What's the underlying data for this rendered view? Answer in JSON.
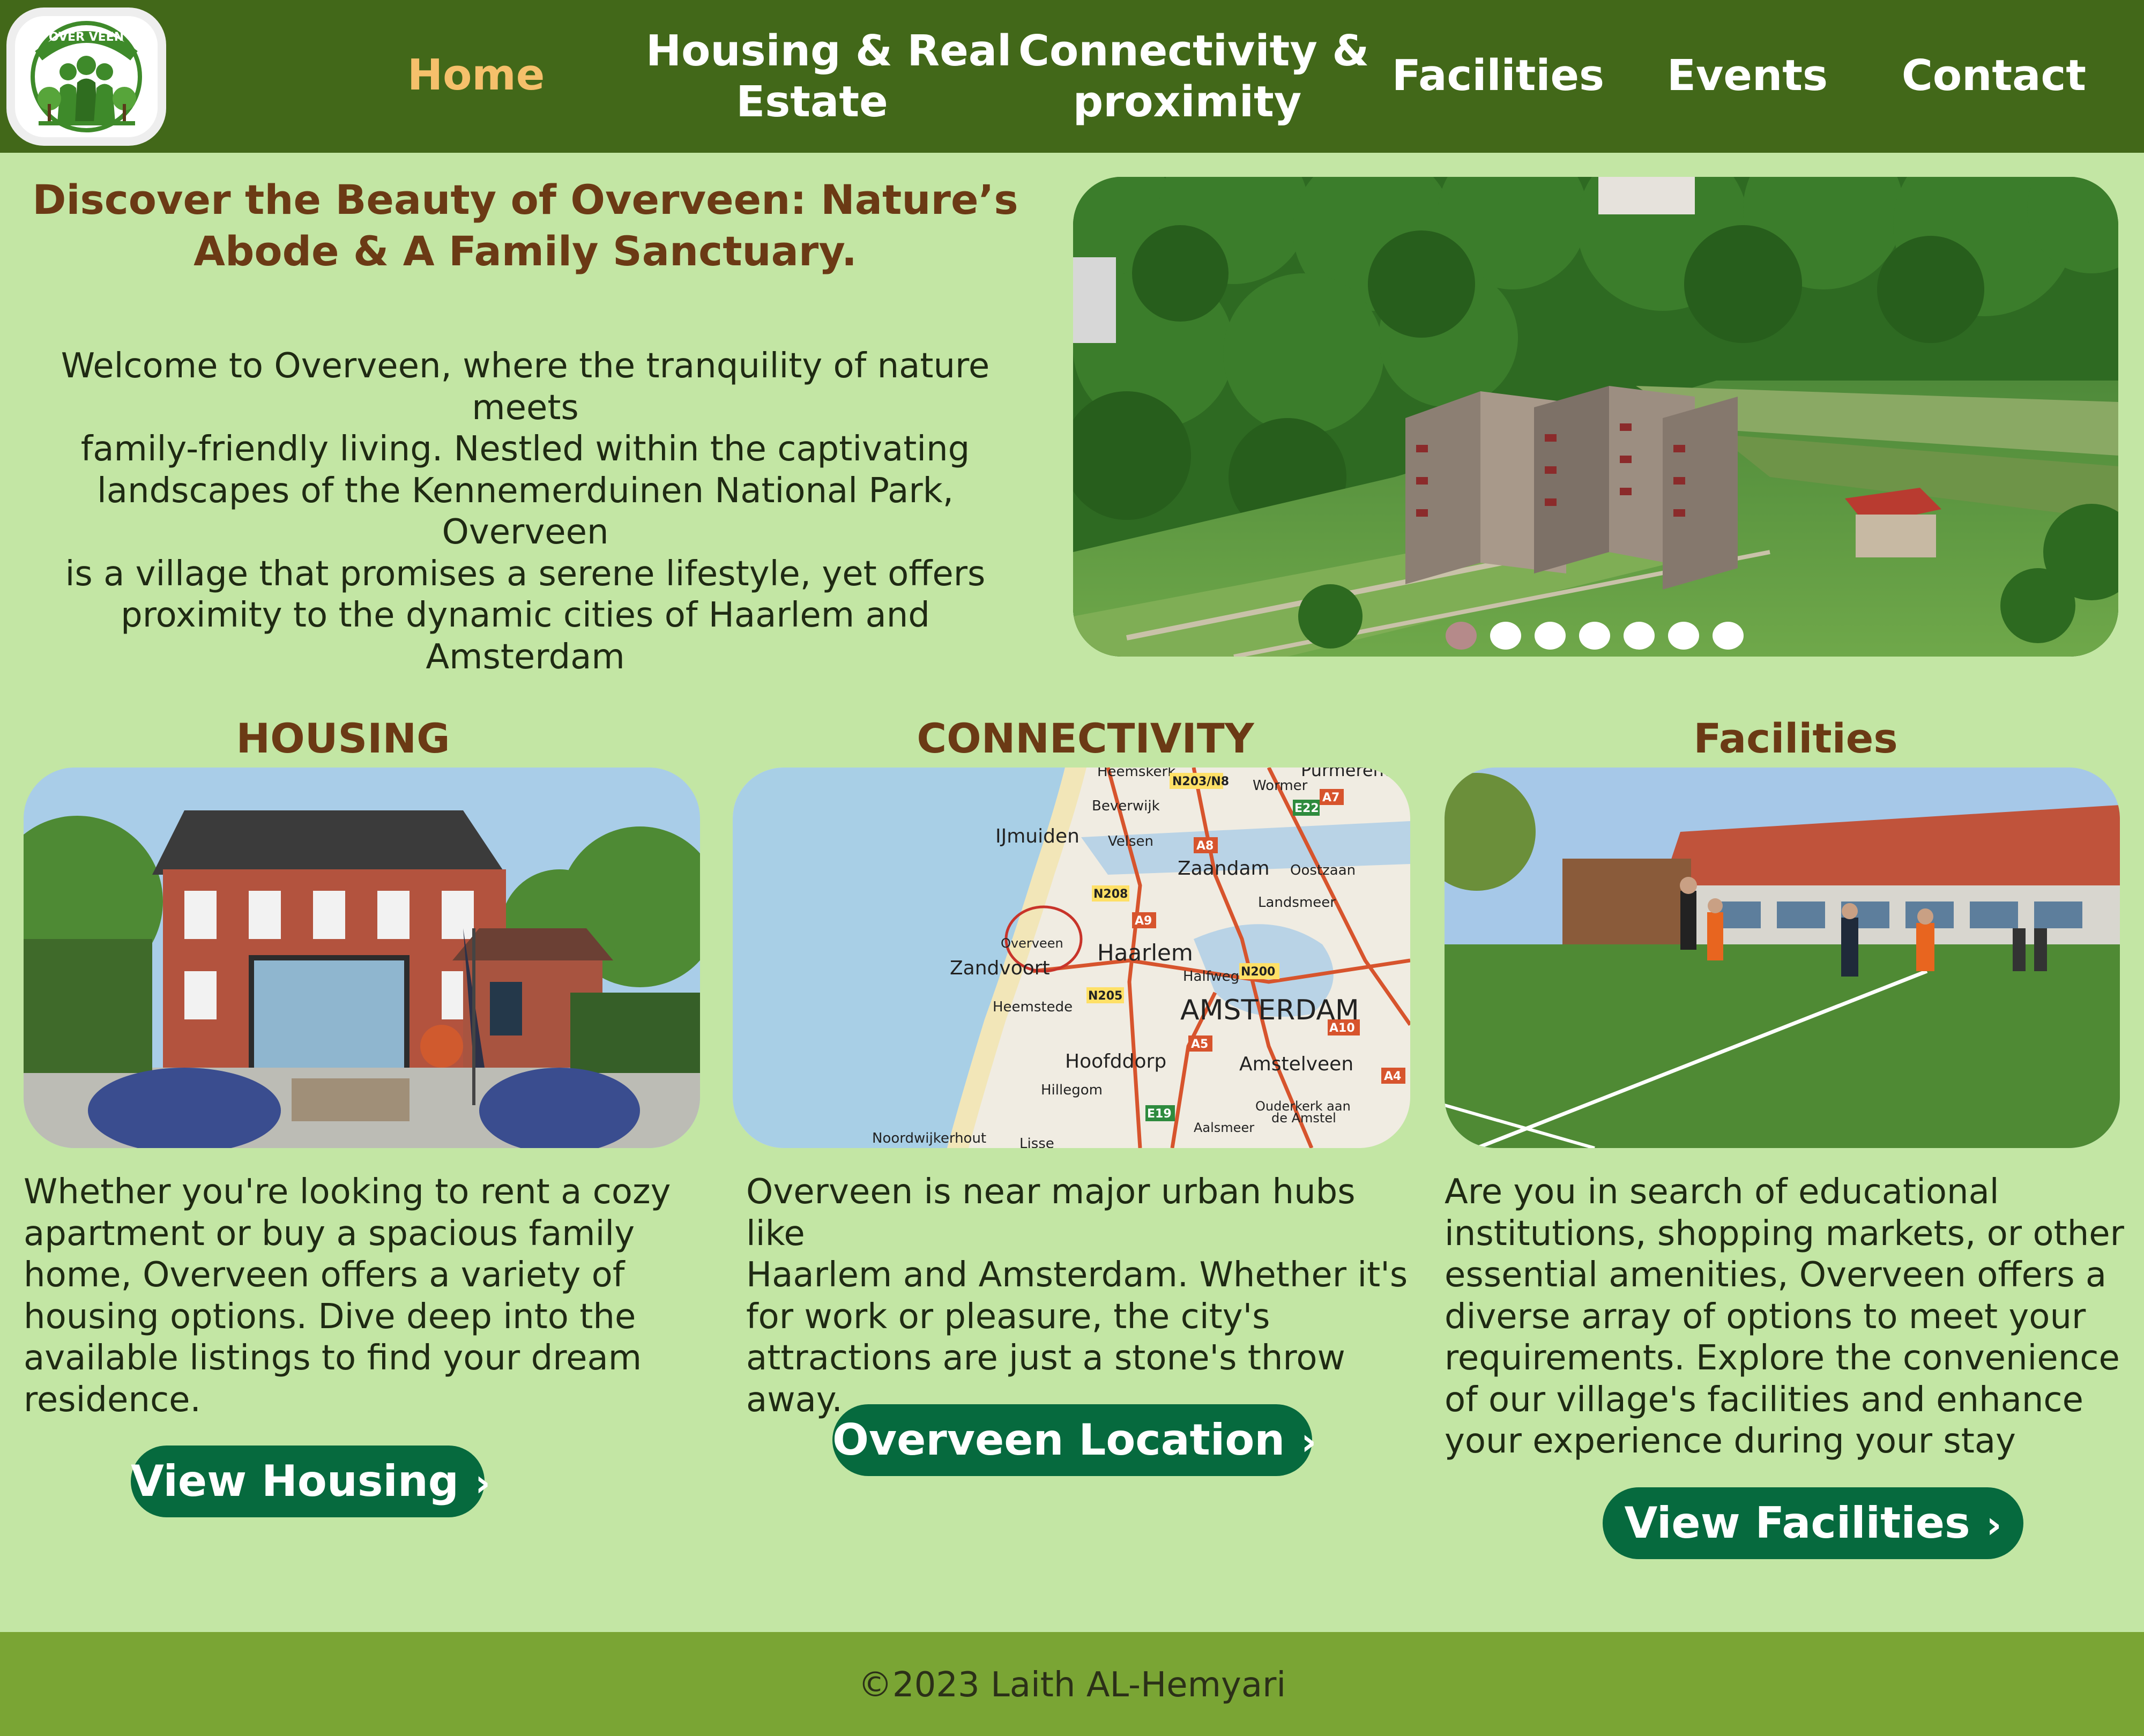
{
  "nav": {
    "items": [
      {
        "label": "Home",
        "active": true
      },
      {
        "label": "Housing & Real",
        "label2": "Estate"
      },
      {
        "label": "Connectivity &",
        "label2": "proximity"
      },
      {
        "label": "Facilities"
      },
      {
        "label": "Events"
      },
      {
        "label": "Contact"
      }
    ],
    "logo_text": "OVER VEEN"
  },
  "hero": {
    "title_line1": "Discover the Beauty of Overveen: Nature’s",
    "title_line2": "Abode & A Family Sanctuary.",
    "lines": [
      "Welcome to Overveen, where the tranquility of nature meets",
      "family-friendly living. Nestled within the captivating",
      "landscapes of the Kennemerduinen National Park, Overveen",
      "is a village that promises a serene lifestyle, yet offers",
      "proximity to the dynamic cities of Haarlem and Amsterdam"
    ],
    "carousel_active_index": 0,
    "carousel_count": 7
  },
  "housing": {
    "title": "HOUSING",
    "lines": [
      "Whether you're looking to rent a cozy",
      "apartment or buy a spacious family",
      "home, Overveen offers a variety of",
      "housing options. Dive deep into the",
      "available listings to find your dream",
      "residence."
    ],
    "button": "View Housing",
    "chevron": "›"
  },
  "connectivity": {
    "title": "CONNECTIVITY",
    "lines": [
      "Overveen is near major urban hubs like",
      "Haarlem and Amsterdam. Whether it's",
      "for work or pleasure, the city's",
      "attractions are just a stone's throw",
      "away."
    ],
    "button": "Overveen Location",
    "chevron": "›",
    "map_labels": {
      "heemskerk": "Heemskerk",
      "purmerend": "Purmerend",
      "beverwijk": "Beverwijk",
      "wormer": "Wormer",
      "ijmuiden": "IJmuiden",
      "velsen": "Velsen",
      "zaandam": "Zaandam",
      "oostzaan": "Oostzaan",
      "landsmeer": "Landsmeer",
      "overveen": "Overveen",
      "haarlem": "Haarlem",
      "zandvoort": "Zandvoort",
      "halfweg": "Halfweg",
      "heemstede": "Heemstede",
      "amsterdam": "AMSTERDAM",
      "hoofddorp": "Hoofddorp",
      "amstelveen": "Amstelveen",
      "hillegom": "Hillegom",
      "ouderkerk": "Ouderkerk aan",
      "deamstel": "de Amstel",
      "aalsmeer": "Aalsmeer",
      "noordwijkerhout": "Noordwijkerhout",
      "lisse": "Lisse",
      "a9": "A9",
      "a8": "A8",
      "a7": "A7",
      "a10": "A10",
      "a5": "A5",
      "a4": "A4",
      "n208": "N208",
      "n205": "N205",
      "n200": "N200",
      "n203": "N203/N8",
      "e22": "E22",
      "e19": "E19"
    }
  },
  "facilities": {
    "title": "Facilities",
    "lines": [
      "Are you in search of educational",
      "institutions, shopping markets, or other",
      "essential amenities, Overveen offers a",
      "diverse array of options to meet your",
      "requirements. Explore the convenience",
      "of our village's facilities and enhance",
      "your experience during your stay"
    ],
    "button": "View Facilities",
    "chevron": "›"
  },
  "footer": {
    "text": "©2023 Laith AL-Hemyari"
  },
  "colors": {
    "header": "#426819",
    "page": "#c3e6a4",
    "title_brown": "#6b3a15",
    "active_nav": "#f5c06b",
    "button": "#066a3e",
    "footer": "#7aa534"
  }
}
